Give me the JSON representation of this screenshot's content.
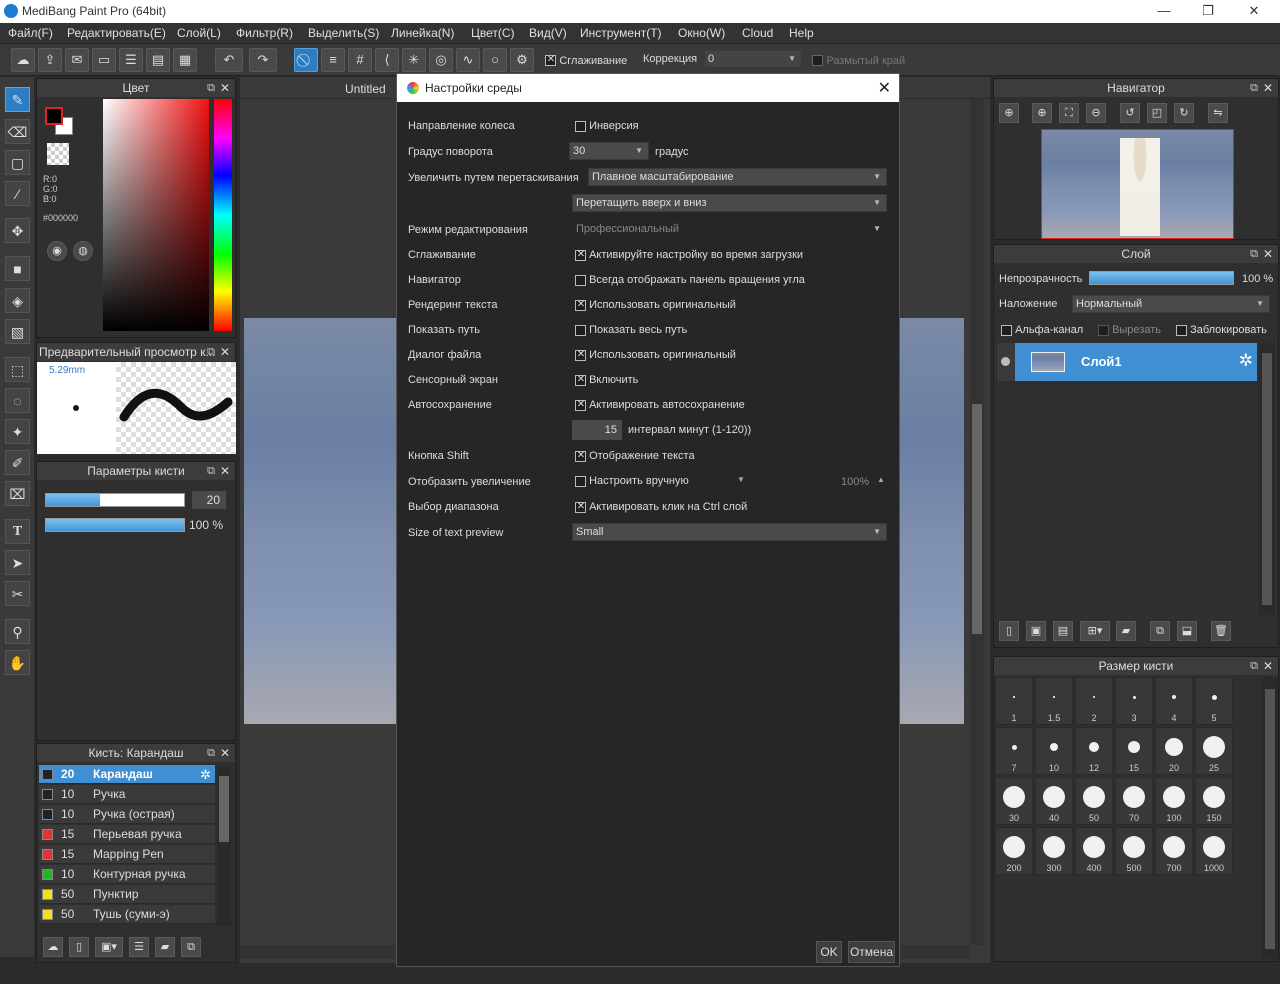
{
  "app": {
    "title": "MediBang Paint Pro (64bit)"
  },
  "menu": [
    "Файл(F)",
    "Редактировать(E)",
    "Слой(L)",
    "Фильтр(R)",
    "Выделить(S)",
    "Линейка(N)",
    "Цвет(C)",
    "Вид(V)",
    "Инструмент(T)",
    "Окно(W)",
    "Cloud",
    "Help"
  ],
  "toolbar": {
    "smoothing_label": "Сглаживание",
    "correction_label": "Коррекция",
    "correction_value": "0",
    "blur_label": "Размытый край"
  },
  "color_panel": {
    "title": "Цвет",
    "r": "R:0",
    "g": "G:0",
    "b": "B:0",
    "hex": "#000000"
  },
  "preview_panel": {
    "title": "Предварительный просмотр к...",
    "size": "5.29mm"
  },
  "brush_params": {
    "title": "Параметры кисти",
    "size": "20",
    "opacity": "100 %",
    "size_frac": 0.39,
    "opacity_frac": 1.0
  },
  "brush_list": {
    "title": "Кисть: Карандаш",
    "items": [
      {
        "size": "20",
        "name": "Карандаш",
        "color": "#222222"
      },
      {
        "size": "10",
        "name": "Ручка",
        "color": "#222222"
      },
      {
        "size": "10",
        "name": "Ручка (острая)",
        "color": "#222222"
      },
      {
        "size": "15",
        "name": "Перьевая ручка",
        "color": "#e23232"
      },
      {
        "size": "15",
        "name": "Mapping Pen",
        "color": "#e23232"
      },
      {
        "size": "10",
        "name": "Контурная ручка",
        "color": "#28b428"
      },
      {
        "size": "50",
        "name": "Пунктир",
        "color": "#f0e020"
      },
      {
        "size": "50",
        "name": "Тушь (суми-э)",
        "color": "#f0e020"
      }
    ]
  },
  "canvas": {
    "tab": "Untitled"
  },
  "dialog": {
    "title": "Настройки среды",
    "rows": {
      "wheel": {
        "label": "Направление колеса",
        "value": "Инверсия",
        "checked": false
      },
      "rotate": {
        "label": "Градус поворота",
        "value": "30",
        "unit": "градус"
      },
      "zoomdrag": {
        "label": "Увеличить путем перетаскивания",
        "value": "Плавное масштабирование",
        "value2": "Перетащить вверх и вниз"
      },
      "editmode": {
        "label": "Режим редактирования",
        "value": "Профессиональный"
      },
      "smoothing": {
        "label": "Сглаживание",
        "value": "Активируйте настройку во время загрузки",
        "checked": true
      },
      "navigator": {
        "label": "Навигатор",
        "value": "Всегда отображать панель вращения угла",
        "checked": false
      },
      "textrender": {
        "label": "Рендеринг текста",
        "value": "Использовать оригинальный",
        "checked": true
      },
      "showpath": {
        "label": "Показать путь",
        "value": "Показать весь путь",
        "checked": false
      },
      "filedialog": {
        "label": "Диалог файла",
        "value": "Использовать оригинальный",
        "checked": true
      },
      "touch": {
        "label": "Сенсорный экран",
        "value": "Включить",
        "checked": true
      },
      "autosave": {
        "label": "Автосохранение",
        "value": "Активировать автосохранение",
        "checked": true,
        "minutes": "15",
        "minutes_label": "интервал минут (1-120))"
      },
      "shift": {
        "label": "Кнопка Shift",
        "value": "Отображение текста",
        "checked": true
      },
      "zoomdisp": {
        "label": "Отобразить увеличение",
        "value": "Настроить вручную",
        "checked": false,
        "percent": "100%"
      },
      "range": {
        "label": "Выбор диапазона",
        "value": "Активировать клик на Ctrl слой",
        "checked": true
      },
      "textprev": {
        "label": "Size of text preview",
        "value": "Small"
      }
    },
    "ok": "OK",
    "cancel": "Отмена"
  },
  "navigator": {
    "title": "Навигатор"
  },
  "layer_panel": {
    "title": "Слой",
    "opacity_label": "Непрозрачность",
    "opacity_value": "100 %",
    "blend_label": "Наложение",
    "blend_value": "Нормальный",
    "alpha_label": "Альфа-канал",
    "clip_label": "Вырезать",
    "lock_label": "Заблокировать",
    "layer_name": "Слой1"
  },
  "brush_size_panel": {
    "title": "Размер кисти",
    "sizes": [
      "1",
      "1.5",
      "2",
      "3",
      "4",
      "5",
      "7",
      "10",
      "12",
      "15",
      "20",
      "25",
      "30",
      "40",
      "50",
      "70",
      "100",
      "150",
      "200",
      "300",
      "400",
      "500",
      "700",
      "1000"
    ]
  }
}
